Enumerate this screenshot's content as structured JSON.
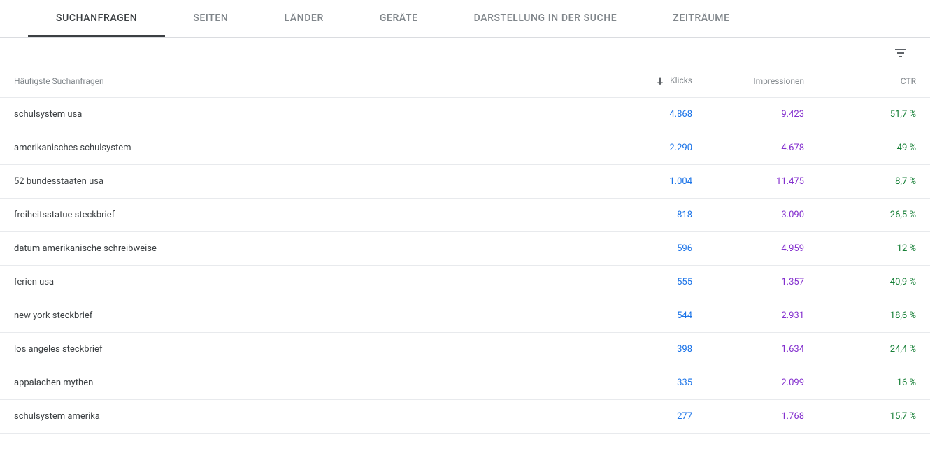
{
  "tabs": {
    "queries": "SUCHANFRAGEN",
    "pages": "SEITEN",
    "countries": "LÄNDER",
    "devices": "GERÄTE",
    "search_appearance": "DARSTELLUNG IN DER SUCHE",
    "dates": "ZEITRÄUME"
  },
  "headers": {
    "query": "Häufigste Suchanfragen",
    "clicks": "Klicks",
    "impressions": "Impressionen",
    "ctr": "CTR"
  },
  "rows": [
    {
      "query": "schulsystem usa",
      "clicks": "4.868",
      "impressions": "9.423",
      "ctr": "51,7 %"
    },
    {
      "query": "amerikanisches schulsystem",
      "clicks": "2.290",
      "impressions": "4.678",
      "ctr": "49 %"
    },
    {
      "query": "52 bundesstaaten usa",
      "clicks": "1.004",
      "impressions": "11.475",
      "ctr": "8,7 %"
    },
    {
      "query": "freiheitsstatue steckbrief",
      "clicks": "818",
      "impressions": "3.090",
      "ctr": "26,5 %"
    },
    {
      "query": "datum amerikanische schreibweise",
      "clicks": "596",
      "impressions": "4.959",
      "ctr": "12 %"
    },
    {
      "query": "ferien usa",
      "clicks": "555",
      "impressions": "1.357",
      "ctr": "40,9 %"
    },
    {
      "query": "new york steckbrief",
      "clicks": "544",
      "impressions": "2.931",
      "ctr": "18,6 %"
    },
    {
      "query": "los angeles steckbrief",
      "clicks": "398",
      "impressions": "1.634",
      "ctr": "24,4 %"
    },
    {
      "query": "appalachen mythen",
      "clicks": "335",
      "impressions": "2.099",
      "ctr": "16 %"
    },
    {
      "query": "schulsystem amerika",
      "clicks": "277",
      "impressions": "1.768",
      "ctr": "15,7 %"
    }
  ]
}
